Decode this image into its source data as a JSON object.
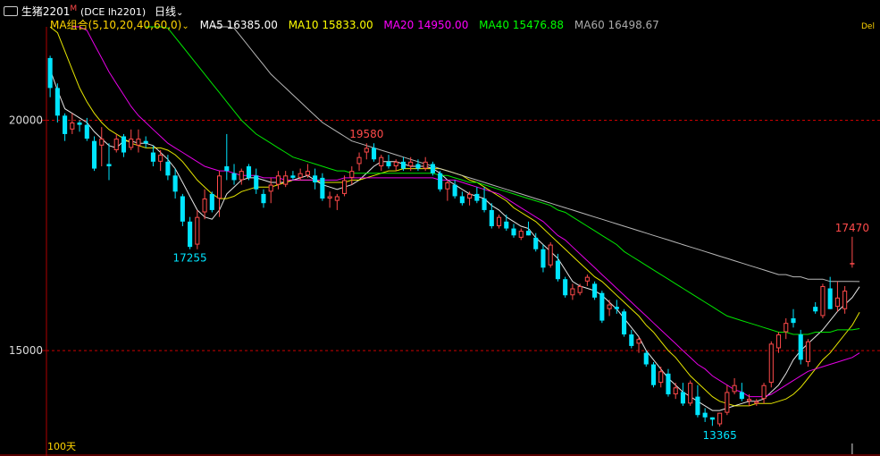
{
  "header": {
    "menu_icon": "menu-icon",
    "symbol": "生猪2201",
    "symbol_mark": "M",
    "exchange_code": "(DCE lh2201)",
    "period": "日线",
    "period_dropdown_icon": "chevron-down-icon",
    "ma_group": "MA组合(5,10,20,40,60,0)",
    "ma_dropdown_icon": "chevron-down-icon",
    "ma5": "MA5 16385.00",
    "ma10": "MA10 15833.00",
    "ma20": "MA20 14950.00",
    "ma40": "MA40 15476.88",
    "ma60": "MA60 16498.67",
    "right_edge": "Del"
  },
  "bottom_label": "100天",
  "annotations": {
    "high_left": "19580",
    "low_left": "17255",
    "low_right": "13365",
    "last_high": "17470"
  },
  "colors": {
    "up": "#ff4a4a",
    "down": "#00e5ff",
    "ma5": "#ffffff",
    "ma10": "#ffff00",
    "ma20": "#ff00ff",
    "ma40": "#00ff00",
    "ma60": "#cccccc",
    "grid": "#cc0000",
    "axis": "#b00000"
  },
  "chart_data": {
    "type": "candlestick",
    "title": "生猪2201 (DCE lh2201) 日线",
    "y_ticks": [
      15000,
      20000
    ],
    "ylim": [
      12750,
      21950
    ],
    "grid": true,
    "candles": [
      [
        21350,
        21400,
        20500,
        20700
      ],
      [
        20700,
        20800,
        19950,
        20100
      ],
      [
        20100,
        20150,
        19550,
        19700
      ],
      [
        19800,
        20150,
        19700,
        19950
      ],
      [
        19950,
        20000,
        19750,
        19900
      ],
      [
        19900,
        20050,
        19550,
        19600
      ],
      [
        19550,
        19650,
        18900,
        18950
      ],
      [
        19450,
        19850,
        19000,
        19600
      ],
      [
        19050,
        19500,
        18700,
        19000
      ],
      [
        19350,
        19700,
        19300,
        19600
      ],
      [
        19650,
        19700,
        19200,
        19300
      ],
      [
        19400,
        19800,
        19350,
        19600
      ],
      [
        19450,
        19800,
        19300,
        19600
      ],
      [
        19550,
        19650,
        19400,
        19500
      ],
      [
        19300,
        19450,
        19000,
        19100
      ],
      [
        19100,
        19350,
        18900,
        19250
      ],
      [
        19100,
        19250,
        18700,
        18800
      ],
      [
        18800,
        18950,
        18300,
        18450
      ],
      [
        18350,
        18400,
        17700,
        17800
      ],
      [
        17800,
        17900,
        17200,
        17250
      ],
      [
        17300,
        18050,
        17200,
        17900
      ],
      [
        18000,
        18500,
        17850,
        18300
      ],
      [
        18400,
        18450,
        18000,
        18050
      ],
      [
        18300,
        18900,
        17900,
        18800
      ],
      [
        19000,
        19700,
        18700,
        18900
      ],
      [
        18850,
        19050,
        18600,
        18700
      ],
      [
        18700,
        18950,
        18600,
        18900
      ],
      [
        19000,
        19050,
        18700,
        18750
      ],
      [
        18800,
        18950,
        18400,
        18500
      ],
      [
        18400,
        18500,
        18100,
        18200
      ],
      [
        18450,
        18750,
        18200,
        18600
      ],
      [
        18600,
        18900,
        18500,
        18800
      ],
      [
        18600,
        18900,
        18550,
        18800
      ],
      [
        18800,
        18900,
        18700,
        18750
      ],
      [
        18750,
        18950,
        18700,
        18850
      ],
      [
        18800,
        19050,
        18750,
        18900
      ],
      [
        18800,
        18950,
        18500,
        18650
      ],
      [
        18750,
        18850,
        18250,
        18300
      ],
      [
        18300,
        18450,
        18100,
        18350
      ],
      [
        18250,
        18400,
        18050,
        18350
      ],
      [
        18400,
        18800,
        18350,
        18700
      ],
      [
        18750,
        19000,
        18600,
        18900
      ],
      [
        19050,
        19300,
        18900,
        19200
      ],
      [
        19300,
        19500,
        19150,
        19400
      ],
      [
        19400,
        19500,
        19100,
        19150
      ],
      [
        19000,
        19250,
        18900,
        19200
      ],
      [
        19100,
        19250,
        18950,
        19000
      ],
      [
        19000,
        19150,
        18900,
        19100
      ],
      [
        19100,
        19200,
        18900,
        18950
      ],
      [
        19000,
        19200,
        18900,
        19100
      ],
      [
        19050,
        19150,
        18900,
        18950
      ],
      [
        18950,
        19200,
        18900,
        19100
      ],
      [
        19050,
        19100,
        18800,
        18850
      ],
      [
        18850,
        18900,
        18450,
        18500
      ],
      [
        18500,
        18700,
        18250,
        18650
      ],
      [
        18600,
        18700,
        18300,
        18350
      ],
      [
        18350,
        18450,
        18150,
        18200
      ],
      [
        18300,
        18450,
        18150,
        18400
      ],
      [
        18400,
        18550,
        18200,
        18250
      ],
      [
        18300,
        18550,
        18000,
        18050
      ],
      [
        18050,
        18200,
        17650,
        17700
      ],
      [
        17700,
        17950,
        17650,
        17900
      ],
      [
        17800,
        17950,
        17600,
        17650
      ],
      [
        17650,
        17750,
        17450,
        17500
      ],
      [
        17450,
        17650,
        17400,
        17600
      ],
      [
        17600,
        17800,
        17500,
        17500
      ],
      [
        17450,
        17550,
        17150,
        17200
      ],
      [
        17200,
        17300,
        16700,
        16800
      ],
      [
        16850,
        17350,
        16800,
        17300
      ],
      [
        16950,
        17100,
        16500,
        16550
      ],
      [
        16550,
        16600,
        16150,
        16200
      ],
      [
        16200,
        16450,
        16100,
        16350
      ],
      [
        16250,
        16450,
        16200,
        16400
      ],
      [
        16500,
        16650,
        16400,
        16600
      ],
      [
        16450,
        16500,
        16100,
        16150
      ],
      [
        16250,
        16300,
        15600,
        15650
      ],
      [
        15900,
        16100,
        15750,
        16000
      ],
      [
        15950,
        16100,
        15800,
        15900
      ],
      [
        15850,
        15900,
        15300,
        15350
      ],
      [
        15350,
        15450,
        15050,
        15100
      ],
      [
        15150,
        15300,
        14950,
        15250
      ],
      [
        14950,
        15000,
        14650,
        14700
      ],
      [
        14700,
        14750,
        14200,
        14250
      ],
      [
        14300,
        14650,
        14200,
        14550
      ],
      [
        14500,
        14600,
        14000,
        14050
      ],
      [
        14050,
        14300,
        13950,
        14200
      ],
      [
        14100,
        14300,
        13800,
        13850
      ],
      [
        13850,
        14350,
        13800,
        14300
      ],
      [
        14000,
        14250,
        13550,
        13600
      ],
      [
        13650,
        13750,
        13450,
        13550
      ],
      [
        13550,
        13550,
        13365,
        13500
      ],
      [
        13400,
        13650,
        13350,
        13650
      ],
      [
        13650,
        14250,
        13600,
        14100
      ],
      [
        14100,
        14400,
        14050,
        14250
      ],
      [
        14100,
        14300,
        13900,
        13950
      ],
      [
        13900,
        14050,
        13800,
        13950
      ],
      [
        13850,
        13950,
        13800,
        13900
      ],
      [
        13950,
        14300,
        13850,
        14250
      ],
      [
        14300,
        15200,
        14200,
        15150
      ],
      [
        15050,
        15400,
        14950,
        15350
      ],
      [
        15400,
        15700,
        15250,
        15600
      ],
      [
        15700,
        15900,
        15500,
        15600
      ],
      [
        15350,
        15450,
        14700,
        14800
      ],
      [
        14750,
        15250,
        14650,
        15200
      ],
      [
        15950,
        16050,
        15800,
        15850
      ],
      [
        15750,
        16450,
        15700,
        16400
      ],
      [
        16350,
        16600,
        15900,
        15900
      ],
      [
        15950,
        16500,
        15850,
        16150
      ],
      [
        15900,
        16400,
        15800,
        16300
      ],
      [
        16900,
        17470,
        16800,
        16900
      ]
    ],
    "series": [
      {
        "name": "MA5",
        "values": [
          21100,
          20650,
          20250,
          20150,
          20050,
          19950,
          19750,
          19600,
          19450,
          19400,
          19550,
          19550,
          19500,
          19500,
          19450,
          19300,
          19150,
          18950,
          18650,
          18350,
          18050,
          17900,
          17850,
          18050,
          18400,
          18550,
          18700,
          18750,
          18750,
          18700,
          18650,
          18650,
          18650,
          18700,
          18750,
          18800,
          18700,
          18600,
          18550,
          18500,
          18550,
          18600,
          18700,
          18850,
          19000,
          19100,
          19100,
          19100,
          19050,
          19000,
          19000,
          19000,
          18950,
          18850,
          18700,
          18600,
          18500,
          18400,
          18350,
          18300,
          18150,
          18050,
          17900,
          17800,
          17700,
          17650,
          17450,
          17300,
          17150,
          17000,
          16750,
          16500,
          16400,
          16350,
          16300,
          16200,
          16050,
          15900,
          15700,
          15500,
          15300,
          15000,
          14800,
          14600,
          14400,
          14250,
          14100,
          14000,
          13900,
          13800,
          13700,
          13700,
          13750,
          13800,
          13850,
          13900,
          13900,
          13950,
          14100,
          14250,
          14500,
          14800,
          15000,
          15150,
          15300,
          15450,
          15650,
          15850,
          16000,
          16150,
          16385
        ]
      },
      {
        "name": "MA10",
        "values": [
          22200,
          21900,
          21500,
          21100,
          20700,
          20400,
          20150,
          19950,
          19800,
          19700,
          19600,
          19500,
          19450,
          19400,
          19400,
          19400,
          19350,
          19250,
          19100,
          18900,
          18700,
          18550,
          18400,
          18300,
          18300,
          18350,
          18450,
          18500,
          18550,
          18550,
          18550,
          18600,
          18650,
          18700,
          18700,
          18700,
          18700,
          18650,
          18650,
          18650,
          18650,
          18700,
          18700,
          18750,
          18800,
          18850,
          18900,
          18900,
          18950,
          18950,
          18950,
          18950,
          18950,
          18950,
          18900,
          18850,
          18800,
          18700,
          18650,
          18550,
          18450,
          18350,
          18250,
          18100,
          18000,
          17900,
          17800,
          17650,
          17500,
          17350,
          17200,
          17050,
          16900,
          16750,
          16600,
          16500,
          16350,
          16200,
          16050,
          15900,
          15750,
          15550,
          15400,
          15200,
          15000,
          14850,
          14650,
          14450,
          14300,
          14150,
          14000,
          13900,
          13850,
          13800,
          13800,
          13800,
          13850,
          13850,
          13850,
          13900,
          13950,
          14050,
          14200,
          14400,
          14600,
          14800,
          14950,
          15150,
          15350,
          15550,
          15833
        ]
      },
      {
        "name": "MA20",
        "values": [
          23500,
          23200,
          22900,
          22600,
          22300,
          21950,
          21650,
          21350,
          21050,
          20800,
          20550,
          20300,
          20100,
          19950,
          19800,
          19650,
          19500,
          19400,
          19300,
          19200,
          19100,
          19000,
          18950,
          18900,
          18900,
          18850,
          18800,
          18800,
          18800,
          18750,
          18750,
          18750,
          18700,
          18700,
          18700,
          18700,
          18700,
          18700,
          18700,
          18700,
          18750,
          18750,
          18750,
          18750,
          18750,
          18750,
          18750,
          18750,
          18750,
          18750,
          18750,
          18750,
          18750,
          18700,
          18700,
          18700,
          18650,
          18600,
          18550,
          18500,
          18450,
          18400,
          18300,
          18200,
          18100,
          18000,
          17900,
          17800,
          17650,
          17500,
          17400,
          17250,
          17100,
          16950,
          16800,
          16650,
          16500,
          16350,
          16200,
          16050,
          15900,
          15750,
          15600,
          15450,
          15300,
          15150,
          15000,
          14850,
          14700,
          14600,
          14450,
          14350,
          14250,
          14150,
          14100,
          14000,
          14000,
          14000,
          14050,
          14150,
          14250,
          14350,
          14450,
          14550,
          14600,
          14650,
          14700,
          14750,
          14800,
          14850,
          14950
        ]
      },
      {
        "name": "MA40",
        "values": [
          25200,
          25000,
          24800,
          24600,
          24400,
          24200,
          24000,
          23800,
          23600,
          23400,
          23200,
          23000,
          22800,
          22600,
          22400,
          22200,
          22000,
          21800,
          21600,
          21400,
          21200,
          21000,
          20800,
          20600,
          20400,
          20200,
          20000,
          19850,
          19700,
          19600,
          19500,
          19400,
          19300,
          19200,
          19150,
          19100,
          19050,
          19000,
          18950,
          18900,
          18900,
          18850,
          18850,
          18850,
          18850,
          18850,
          18850,
          18850,
          18850,
          18850,
          18850,
          18850,
          18850,
          18800,
          18800,
          18750,
          18700,
          18650,
          18650,
          18600,
          18550,
          18500,
          18450,
          18400,
          18350,
          18300,
          18250,
          18200,
          18150,
          18050,
          18000,
          17900,
          17800,
          17700,
          17600,
          17500,
          17400,
          17300,
          17150,
          17050,
          16950,
          16850,
          16750,
          16650,
          16550,
          16450,
          16350,
          16250,
          16150,
          16050,
          15950,
          15850,
          15750,
          15700,
          15650,
          15600,
          15550,
          15500,
          15450,
          15400,
          15400,
          15350,
          15350,
          15350,
          15400,
          15400,
          15400,
          15450,
          15450,
          15450,
          15476.88
        ]
      },
      {
        "name": "MA60",
        "values": [
          27000,
          26800,
          26600,
          26400,
          26200,
          26000,
          25800,
          25600,
          25400,
          25200,
          25000,
          24800,
          24600,
          24400,
          24200,
          24000,
          23800,
          23600,
          23400,
          23200,
          23000,
          22800,
          22600,
          22400,
          22200,
          22000,
          21800,
          21600,
          21400,
          21200,
          21000,
          20850,
          20700,
          20550,
          20400,
          20250,
          20100,
          19950,
          19850,
          19750,
          19650,
          19550,
          19500,
          19450,
          19400,
          19350,
          19300,
          19250,
          19200,
          19150,
          19100,
          19050,
          19000,
          18950,
          18900,
          18850,
          18800,
          18750,
          18700,
          18650,
          18600,
          18550,
          18500,
          18450,
          18400,
          18350,
          18300,
          18250,
          18200,
          18150,
          18100,
          18050,
          18000,
          17950,
          17900,
          17850,
          17800,
          17750,
          17700,
          17650,
          17600,
          17550,
          17500,
          17450,
          17400,
          17350,
          17300,
          17250,
          17200,
          17150,
          17100,
          17050,
          17000,
          16950,
          16900,
          16850,
          16800,
          16750,
          16700,
          16650,
          16650,
          16600,
          16600,
          16550,
          16550,
          16550,
          16500,
          16500,
          16500,
          16500,
          16498.67
        ]
      }
    ]
  }
}
